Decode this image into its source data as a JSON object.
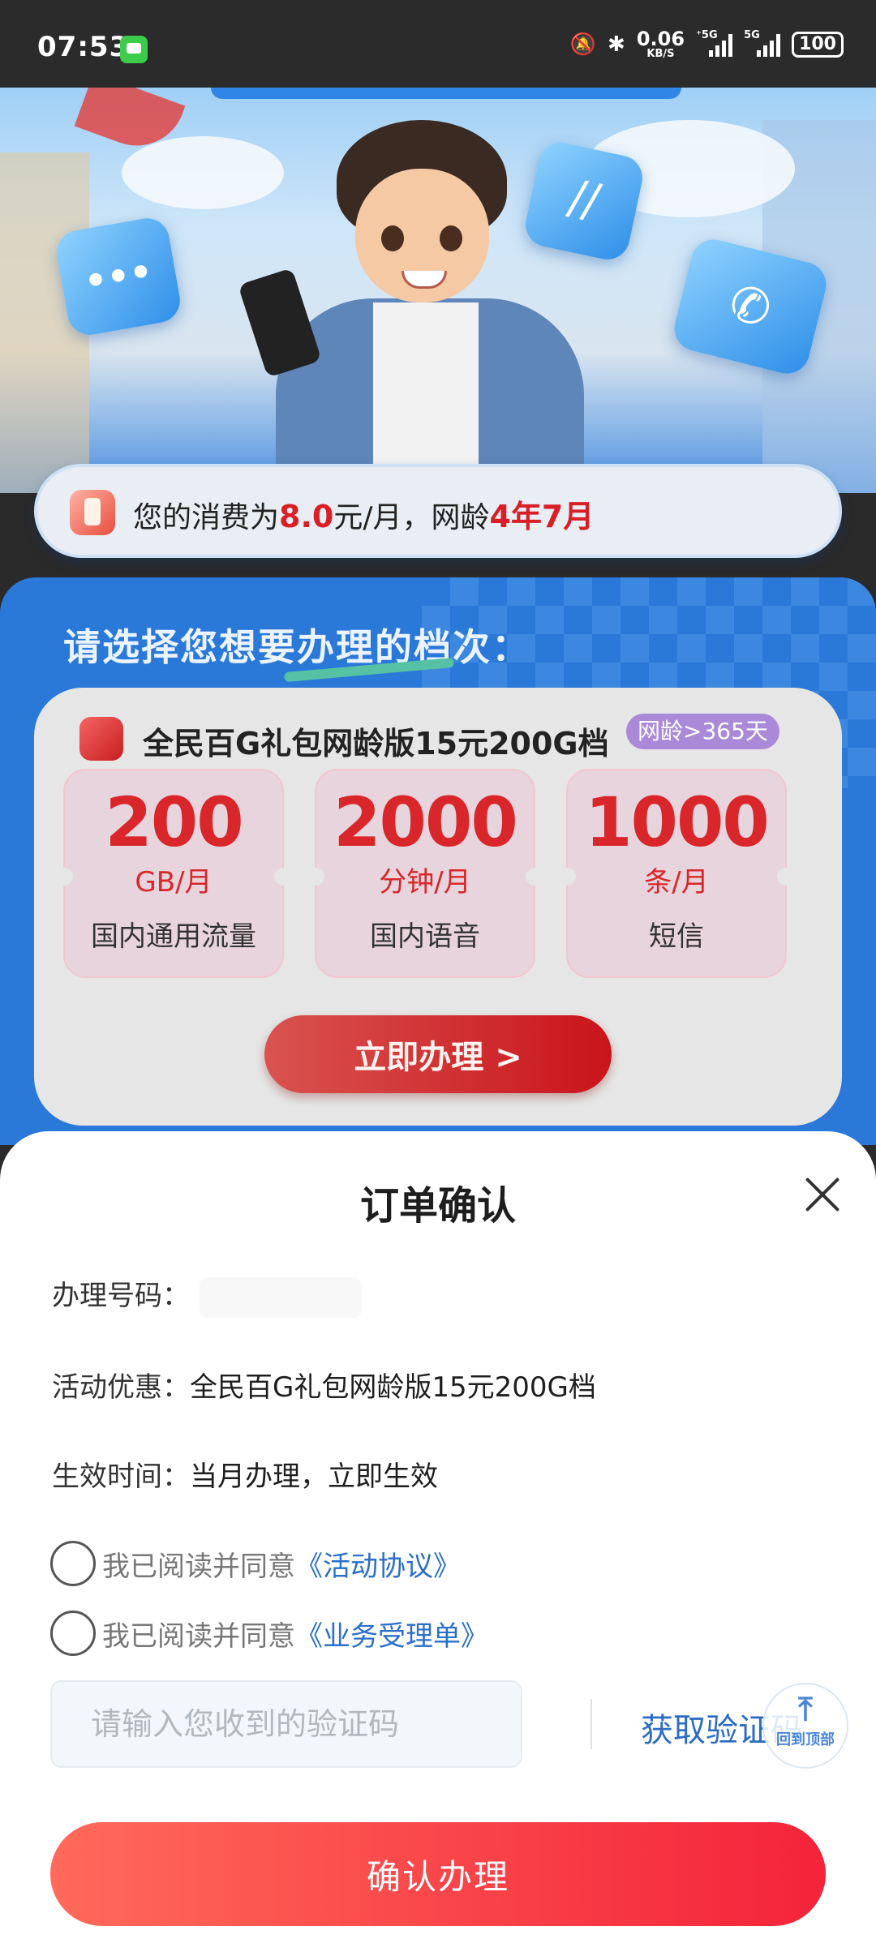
{
  "status_bar": {
    "time": "07:53",
    "net_speed": "0.06",
    "net_unit": "KB/S",
    "signal1_label": "⁺5G",
    "signal2_label": "5G",
    "battery": "100"
  },
  "consume": {
    "prefix": "您的消费为",
    "amount": "8.0",
    "middle": "元/月，网龄",
    "age": "4年7月"
  },
  "choose_title": "请选择您想要办理的档次：",
  "plan": {
    "name": "全民百G礼包网龄版15元200G档",
    "badge": "网龄>365天",
    "features": [
      {
        "num": "200",
        "unit": "GB/月",
        "desc": "国内通用流量"
      },
      {
        "num": "2000",
        "unit": "分钟/月",
        "desc": "国内语音"
      },
      {
        "num": "1000",
        "unit": "条/月",
        "desc": "短信"
      }
    ],
    "apply_label": "立即办理 >"
  },
  "sheet": {
    "title": "订单确认",
    "number_label": "办理号码：",
    "promo_label": "活动优惠：",
    "promo_value": "全民百G礼包网龄版15元200G档",
    "effective_label": "生效时间：",
    "effective_value": "当月办理，立即生效",
    "agree1_text": "我已阅读并同意",
    "agree1_link": "《活动协议》",
    "agree2_text": "我已阅读并同意",
    "agree2_link": "《业务受理单》",
    "code_placeholder": "请输入您收到的验证码",
    "get_code_label": "获取验证码",
    "back_to_top": "回到顶部",
    "confirm_label": "确认办理"
  },
  "colors": {
    "accent_red": "#d91e26",
    "link_blue": "#2a6fc9",
    "section_blue": "#2a78d8",
    "confirm_gradient_start": "#ff6a5a",
    "confirm_gradient_end": "#f4233a"
  }
}
